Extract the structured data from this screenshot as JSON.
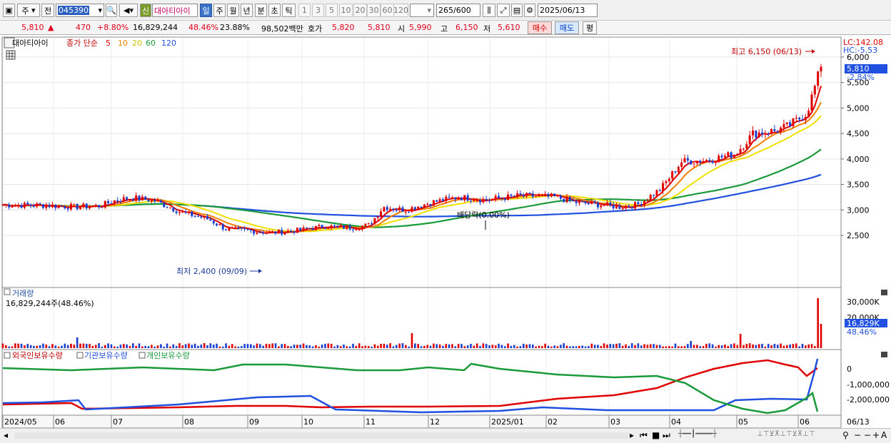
{
  "toolbar": {
    "market": "주",
    "prefix": "전",
    "code": "045390",
    "tag": "신",
    "name": "대아티아이",
    "periods": [
      "일",
      "주",
      "월",
      "년",
      "분",
      "초",
      "틱"
    ],
    "minutes": [
      "1",
      "3",
      "5",
      "10",
      "20",
      "30",
      "60",
      "120"
    ],
    "count": "265",
    "count_max": "/600",
    "date": "2025/06/13"
  },
  "quote": {
    "price": "5,810",
    "change": "470",
    "rate": "+8.80%",
    "volume": "16,829,244",
    "volume_ratio": "48.46%",
    "turnover": "23.88%",
    "amount": "98,502백만",
    "ask_label": "호가",
    "ask": "5,820",
    "bid": "5,810",
    "open_label": "시",
    "open": "5,990",
    "high_label": "고",
    "high": "6,150",
    "low_label": "저",
    "low": "5,610",
    "buy": "매수",
    "sell": "매도",
    "avg": "평"
  },
  "price_panel": {
    "stock_label": "대아티아이",
    "ma_title": "종가 단순",
    "ma": [
      {
        "p": "5",
        "c": "#e00000"
      },
      {
        "p": "10",
        "c": "#f08000"
      },
      {
        "p": "20",
        "c": "#f0e000"
      },
      {
        "p": "60",
        "c": "#1a9a3a"
      },
      {
        "p": "120",
        "c": "#2050e0"
      }
    ],
    "lc": "LC:142.08",
    "hc": "HC:-5.53",
    "y_ticks": [
      "6,000",
      "5,500",
      "5,000",
      "4,500",
      "4,000",
      "3,500",
      "3,000",
      "2,500"
    ],
    "current_price": "5,810",
    "current_pct": "-2.84%",
    "high_annot": "최고 6,150 (06/13)",
    "low_annot": "최저 2,400 (09/09)",
    "dividend_annot": "배당락(0.00%)"
  },
  "volume_panel": {
    "title": "거래량",
    "value": "16,829,244주(48.46%)",
    "y_ticks": [
      "30,000K",
      "20,000K"
    ],
    "current": "16,829K",
    "pct": "48.46%"
  },
  "holdings_panel": {
    "legend": [
      "외국인보유수량",
      "기관보유수량",
      "개인보유수량"
    ],
    "colors": [
      "#e00000",
      "#2050e0",
      "#1a9a3a"
    ],
    "y_ticks": [
      "0",
      "-1,000,000",
      "-2,000,000"
    ]
  },
  "x_axis": [
    "2024/05",
    "06",
    "07",
    "08",
    "09",
    "10",
    "11",
    "12",
    "2025/01",
    "02",
    "03",
    "04",
    "05",
    "06"
  ],
  "x_end": "06/13"
}
